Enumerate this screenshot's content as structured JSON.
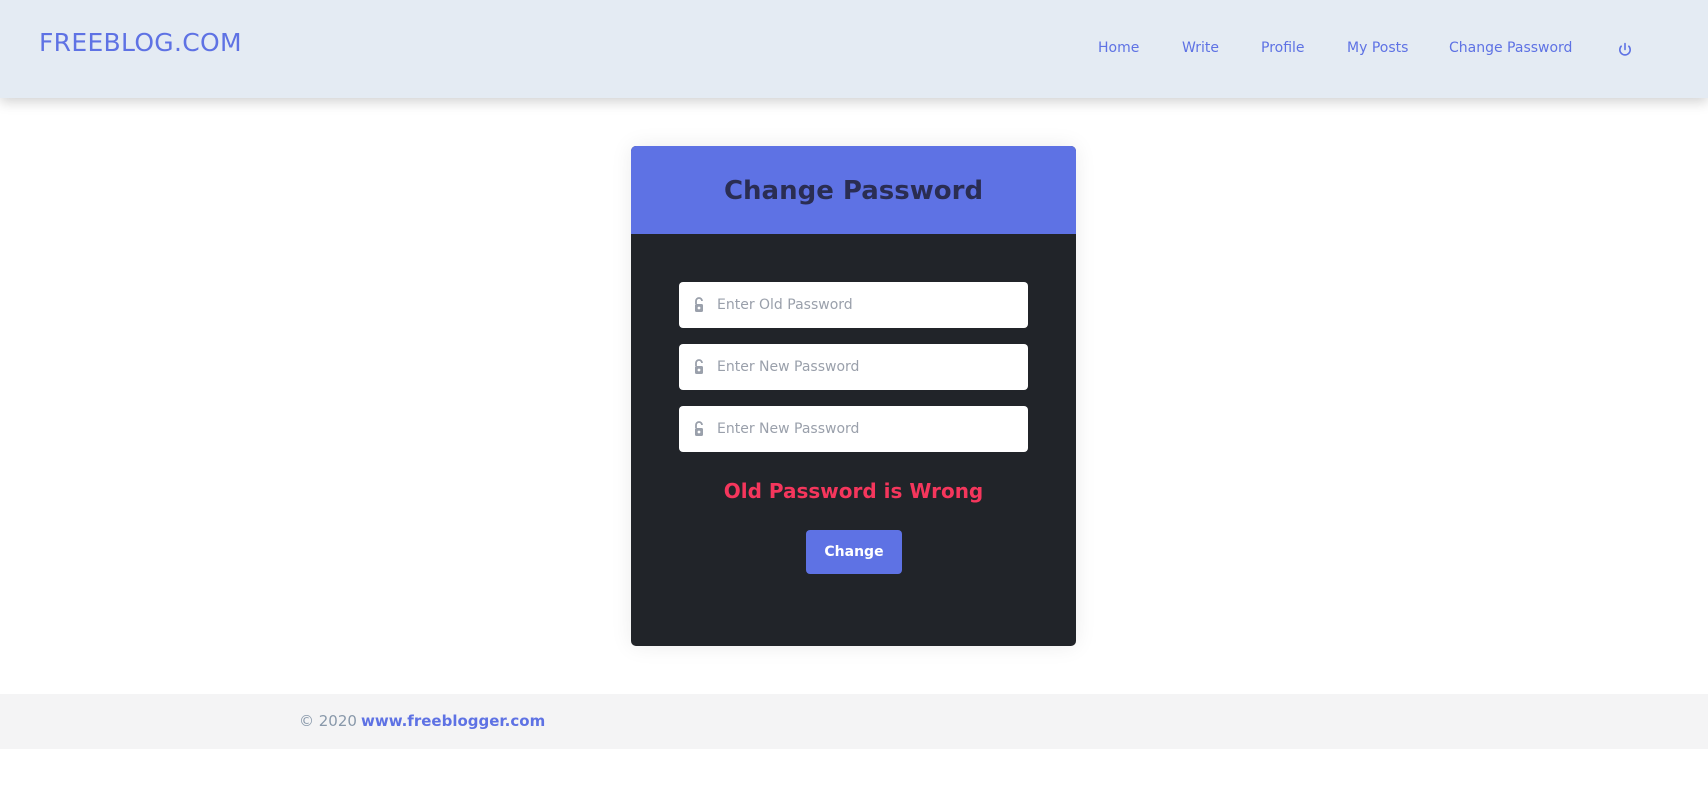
{
  "navbar": {
    "brand": "FREEBLOG.COM",
    "links": [
      "Home",
      "Write",
      "Profile",
      "My Posts",
      "Change Password"
    ],
    "power_icon": "power-icon"
  },
  "card": {
    "title": "Change Password",
    "fields": [
      {
        "placeholder": "Enter Old Password",
        "value": "",
        "icon": "lock-icon"
      },
      {
        "placeholder": "Enter New Password",
        "value": "",
        "icon": "lock-icon"
      },
      {
        "placeholder": "Enter New Password",
        "value": "",
        "icon": "lock-icon"
      }
    ],
    "error_message": "Old Password is Wrong",
    "submit_label": "Change"
  },
  "footer": {
    "copyright": "© 2020",
    "link": "www.freeblogger.com"
  },
  "colors": {
    "accent": "#5e72e4",
    "navbar_bg": "#e4ebf3",
    "card_bg": "#212429",
    "error": "#f5365c",
    "footer_bg": "#f4f4f5"
  }
}
